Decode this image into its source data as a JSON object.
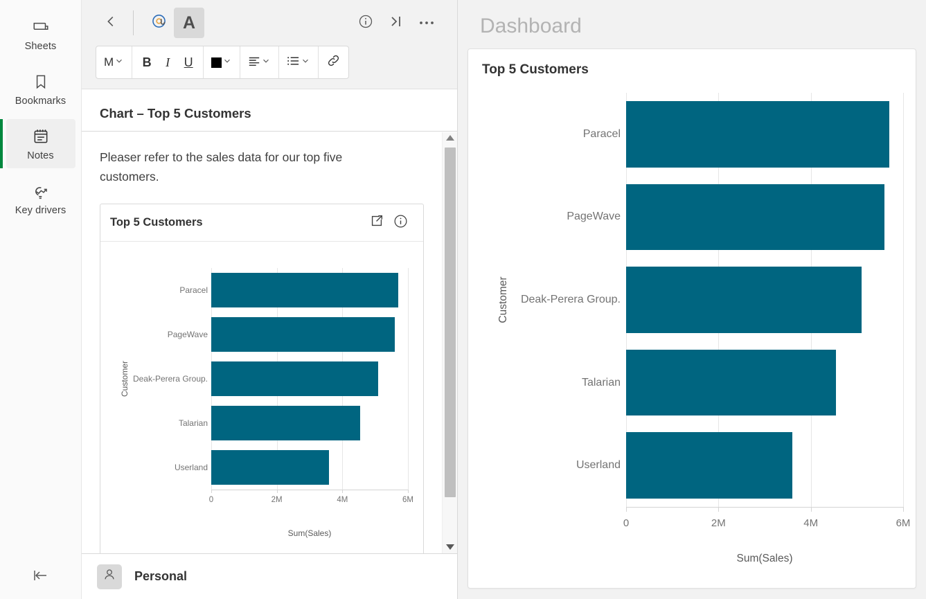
{
  "sidebar": {
    "items": [
      {
        "label": "Sheets",
        "icon": "sheets-icon",
        "active": false
      },
      {
        "label": "Bookmarks",
        "icon": "bookmark-icon",
        "active": false
      },
      {
        "label": "Notes",
        "icon": "notes-icon",
        "active": true
      },
      {
        "label": "Key drivers",
        "icon": "key-drivers-icon",
        "active": false
      }
    ],
    "collapse_icon": "collapse-panel-icon"
  },
  "notes_panel": {
    "toolbar": {
      "back_icon": "chevron-left-icon",
      "mention_icon": "at-mention-icon",
      "text_format_icon": "text-format-icon",
      "info_icon": "info-icon",
      "collapse_icon": "collapse-right-icon",
      "more_icon": "more-options-icon",
      "format": {
        "size_label": "M",
        "bold_label": "B",
        "italic_label": "I",
        "underline_label": "U",
        "color_swatch": "#000000",
        "align_icon": "align-left-icon",
        "list_icon": "bullet-list-icon",
        "link_icon": "link-icon"
      }
    },
    "note_title": "Chart – Top 5 Customers",
    "note_paragraph": "Pleaser refer to the sales data for our top five customers.",
    "embed": {
      "title": "Top 5 Customers",
      "share_icon": "share-export-icon",
      "info_icon": "info-icon"
    },
    "scrollbar": {
      "up_icon": "scroll-up-arrow",
      "down_icon": "scroll-down-arrow"
    },
    "footer": {
      "avatar_icon": "user-avatar-icon",
      "owner": "Personal"
    }
  },
  "dashboard": {
    "title": "Dashboard",
    "card_title": "Top 5 Customers"
  },
  "chart_data": [
    {
      "id": "embedded",
      "type": "bar",
      "orientation": "horizontal",
      "title": "Top 5 Customers",
      "categories": [
        "Paracel",
        "PageWave",
        "Deak-Perera Group.",
        "Talarian",
        "Userland"
      ],
      "values": [
        5700000,
        5600000,
        5100000,
        4550000,
        3600000
      ],
      "xlabel": "Sum(Sales)",
      "ylabel": "Customer",
      "xlim": [
        0,
        6000000
      ],
      "xticks": [
        0,
        2000000,
        4000000,
        6000000
      ],
      "xticklabels": [
        "0",
        "2M",
        "4M",
        "6M"
      ],
      "grid": true,
      "bar_color": "#006580",
      "legend": "none"
    },
    {
      "id": "dashboard",
      "type": "bar",
      "orientation": "horizontal",
      "title": "Top 5 Customers",
      "categories": [
        "Paracel",
        "PageWave",
        "Deak-Perera Group.",
        "Talarian",
        "Userland"
      ],
      "values": [
        5700000,
        5600000,
        5100000,
        4550000,
        3600000
      ],
      "xlabel": "Sum(Sales)",
      "ylabel": "Customer",
      "xlim": [
        0,
        6000000
      ],
      "xticks": [
        0,
        2000000,
        4000000,
        6000000
      ],
      "xticklabels": [
        "0",
        "2M",
        "4M",
        "6M"
      ],
      "grid": true,
      "bar_color": "#006580",
      "legend": "none"
    }
  ]
}
